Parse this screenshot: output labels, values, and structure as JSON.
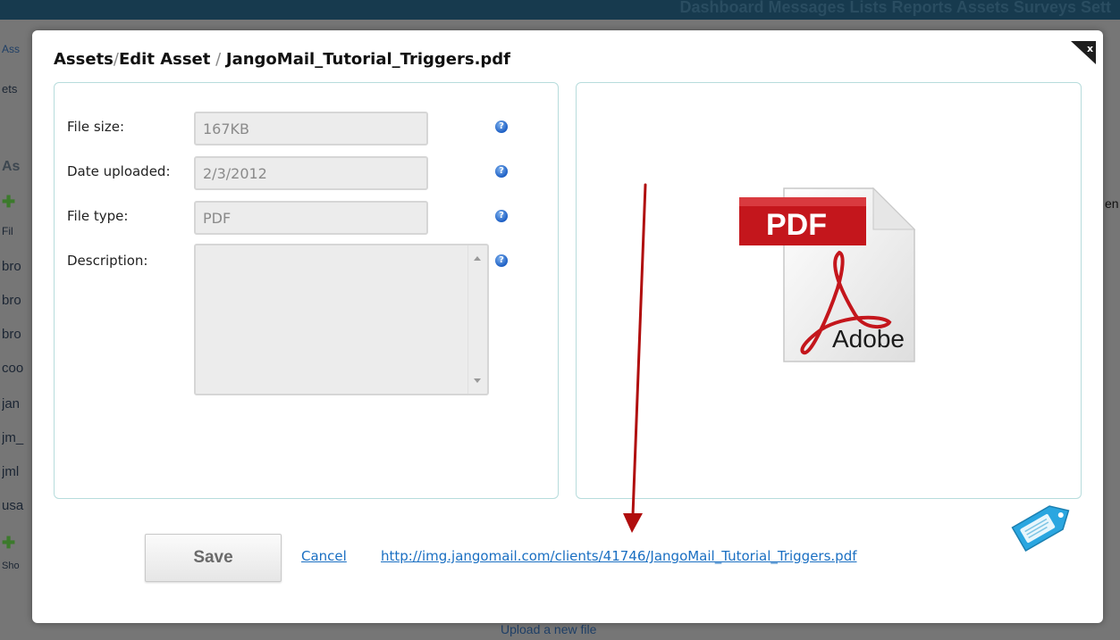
{
  "background": {
    "nav_text": "Dashboard  Messages  Lists  Reports  Assets  Surveys  Sett",
    "left_snippets": [
      "Ass",
      "ets",
      "As",
      "Fil",
      "bro",
      "bro",
      "bro",
      "coo",
      "jan",
      "jm_",
      "jml",
      "usa",
      "Sho"
    ],
    "right_snippet": "en",
    "bottom_link": "Upload a new file"
  },
  "modal": {
    "title": {
      "part1": "Assets",
      "sep1": "/",
      "part2": "Edit Asset",
      "sep2": " / ",
      "part3": "JangoMail_Tutorial_Triggers.pdf"
    },
    "close_icon": "close-icon",
    "fields": {
      "file_size": {
        "label": "File size:",
        "value": "167KB"
      },
      "date_uploaded": {
        "label": "Date uploaded:",
        "value": "2/3/2012"
      },
      "file_type": {
        "label": "File type:",
        "value": "PDF"
      },
      "description": {
        "label": "Description:",
        "value": ""
      }
    },
    "help_icon_glyph": "?",
    "preview": {
      "icon": "pdf-file-icon",
      "badge_text": "PDF",
      "brand_text": "Adobe",
      "badge_color": "#c4161c"
    },
    "footer": {
      "save_label": "Save",
      "cancel_label": "Cancel",
      "url": "http://img.jangomail.com/clients/41746/JangoMail_Tutorial_Triggers.pdf"
    },
    "annotation_arrow_color": "#b00d0d",
    "link_color": "#1a6fc2"
  }
}
